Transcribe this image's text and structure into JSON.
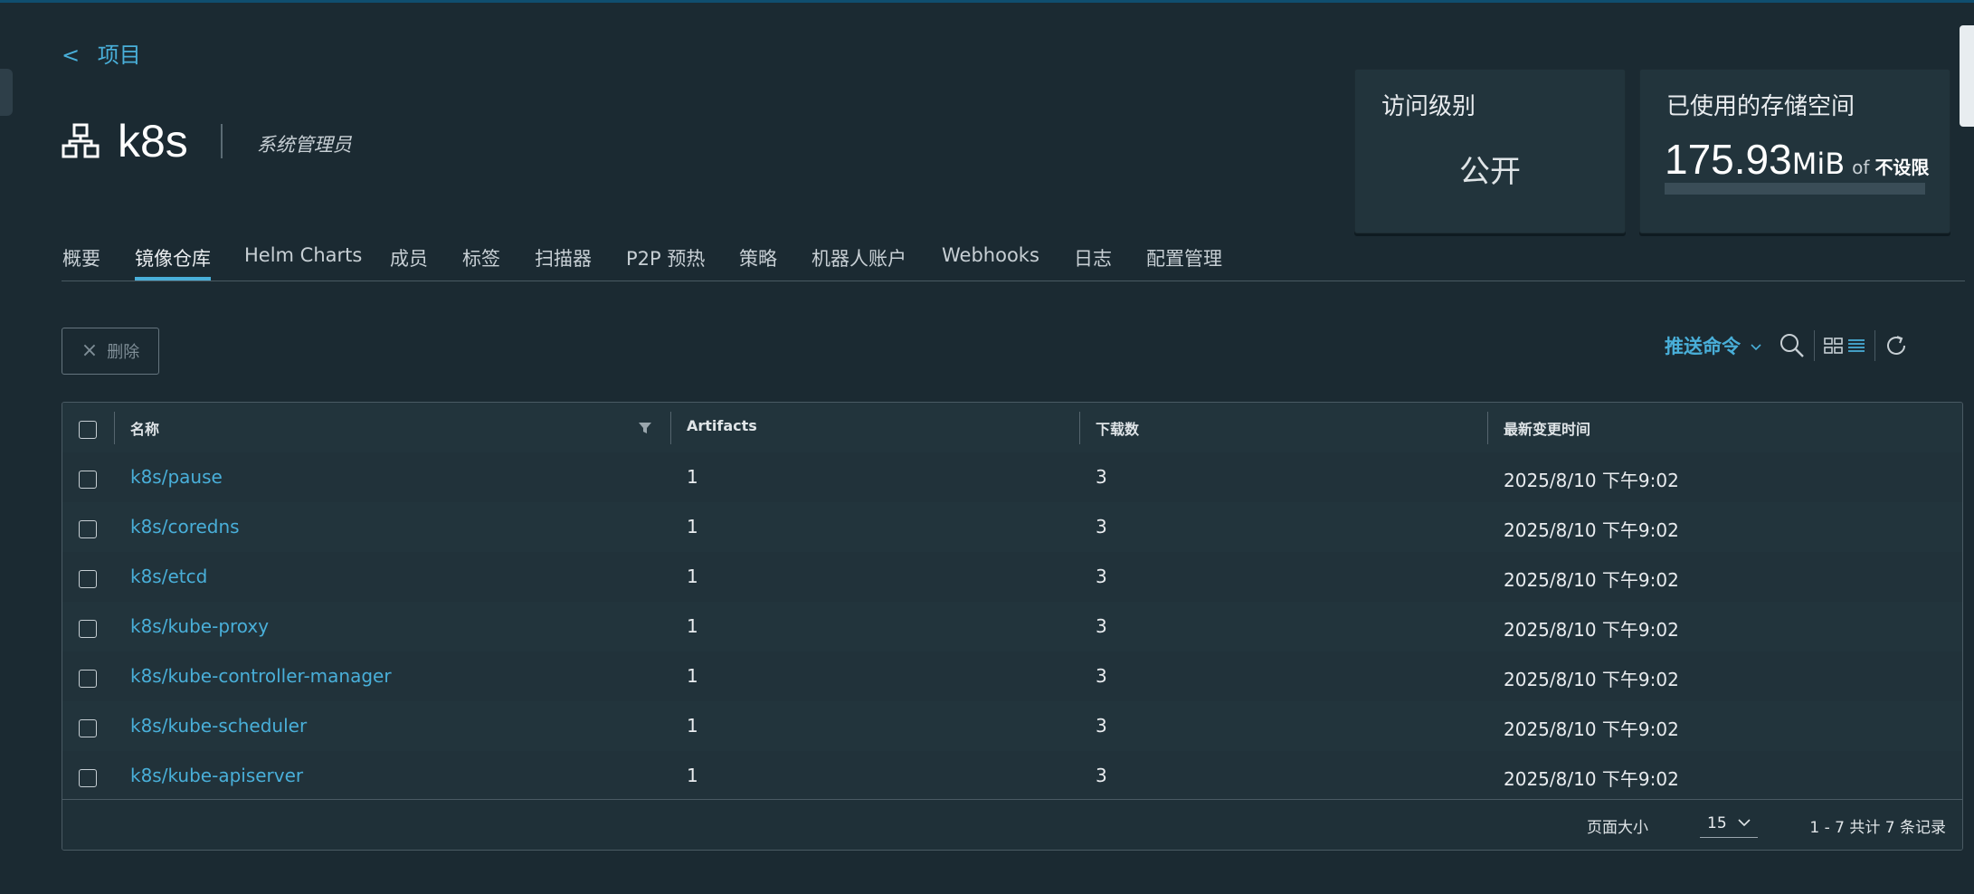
{
  "breadcrumb": {
    "arrow": "<",
    "label": "项目"
  },
  "project": {
    "name": "k8s",
    "role": "系统管理员"
  },
  "access_card": {
    "title": "访问级别",
    "value": "公开"
  },
  "storage_card": {
    "title": "已使用的存储空间",
    "used_number": "175.93",
    "used_unit": "MiB",
    "of_label": "of",
    "limit": "不设限",
    "usage_fraction": 0
  },
  "tabs": [
    {
      "label": "概要"
    },
    {
      "label": "镜像仓库",
      "active": true
    },
    {
      "label": "Helm Charts"
    },
    {
      "label": "成员"
    },
    {
      "label": "标签"
    },
    {
      "label": "扫描器"
    },
    {
      "label": "P2P 预热"
    },
    {
      "label": "策略"
    },
    {
      "label": "机器人账户"
    },
    {
      "label": "Webhooks"
    },
    {
      "label": "日志"
    },
    {
      "label": "配置管理"
    }
  ],
  "toolbar": {
    "delete_label": "删除",
    "push_command_label": "推送命令"
  },
  "table": {
    "columns": [
      "名称",
      "Artifacts",
      "下载数",
      "最新变更时间"
    ],
    "rows": [
      {
        "name": "k8s/pause",
        "artifacts": "1",
        "downloads": "3",
        "updated": "2025/8/10 下午9:02"
      },
      {
        "name": "k8s/coredns",
        "artifacts": "1",
        "downloads": "3",
        "updated": "2025/8/10 下午9:02"
      },
      {
        "name": "k8s/etcd",
        "artifacts": "1",
        "downloads": "3",
        "updated": "2025/8/10 下午9:02"
      },
      {
        "name": "k8s/kube-proxy",
        "artifacts": "1",
        "downloads": "3",
        "updated": "2025/8/10 下午9:02"
      },
      {
        "name": "k8s/kube-controller-manager",
        "artifacts": "1",
        "downloads": "3",
        "updated": "2025/8/10 下午9:02"
      },
      {
        "name": "k8s/kube-scheduler",
        "artifacts": "1",
        "downloads": "3",
        "updated": "2025/8/10 下午9:02"
      },
      {
        "name": "k8s/kube-apiserver",
        "artifacts": "1",
        "downloads": "3",
        "updated": "2025/8/10 下午9:02"
      }
    ]
  },
  "pagination": {
    "page_size_label": "页面大小",
    "page_size": "15",
    "summary": "1 - 7 共计 7 条记录"
  },
  "colors": {
    "accent": "#49afd9",
    "background": "#1b2a32",
    "card": "#22343c"
  },
  "icons": [
    "project-icon",
    "close-icon",
    "chevron-down-icon",
    "search-icon",
    "card-view-icon",
    "list-view-icon",
    "refresh-icon",
    "filter-icon"
  ]
}
